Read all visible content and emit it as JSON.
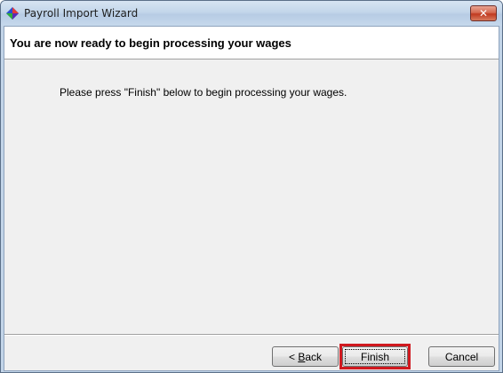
{
  "window": {
    "title": "Payroll Import Wizard",
    "close_glyph": "✕"
  },
  "header": {
    "title": "You are now ready to begin processing your wages"
  },
  "main": {
    "message": "Please press \"Finish\" below to begin processing your wages."
  },
  "buttons": {
    "back_prefix": "< ",
    "back_accel": "B",
    "back_rest": "ack",
    "finish": "Finish",
    "cancel": "Cancel"
  },
  "colors": {
    "highlight": "#d0191f",
    "header_bg": "#ffffff",
    "body_bg": "#f0f0f0"
  },
  "icons": {
    "app": "payroll-app-icon",
    "close": "close-icon"
  }
}
